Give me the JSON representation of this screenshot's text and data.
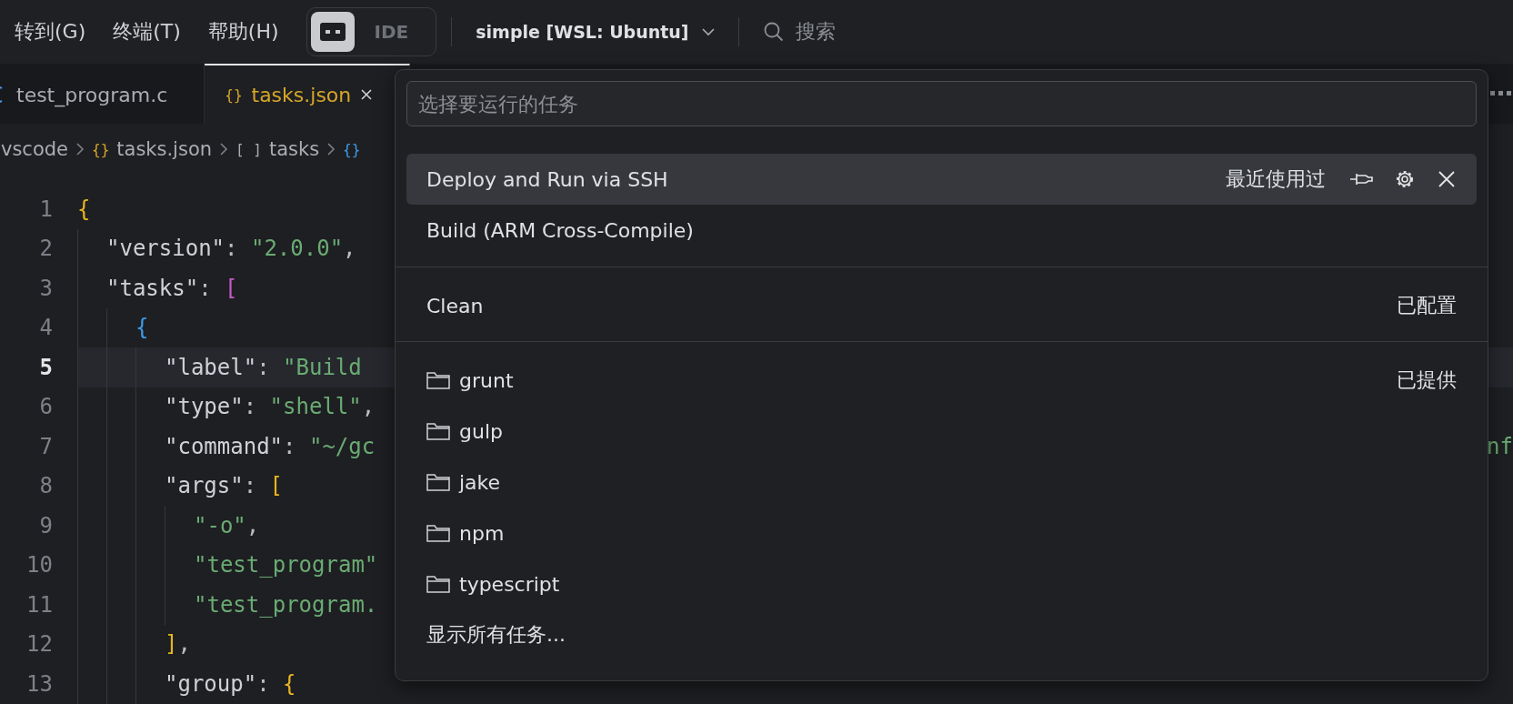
{
  "menu": [
    {
      "label": "转到(G)"
    },
    {
      "label": "终端(T)"
    },
    {
      "label": "帮助(H)"
    }
  ],
  "layout_toggle": {
    "label": "IDE",
    "icon_selected": true
  },
  "workspace": {
    "label": "simple [WSL: Ubuntu]"
  },
  "search": {
    "placeholder": "搜索"
  },
  "tabs": [
    {
      "label": "test_program.c",
      "kind": "c",
      "selected": false
    },
    {
      "label": "tasks.json",
      "kind": "json",
      "icon": "{}",
      "selected": true
    }
  ],
  "breadcrumb": [
    {
      "label": "vscode"
    },
    {
      "label": "tasks.json",
      "kind": "json",
      "icon": "{}"
    },
    {
      "label": "tasks",
      "kind": "array",
      "icon": "[ ]"
    },
    {
      "kind": "object",
      "icon": "{}"
    }
  ],
  "code": [
    {
      "number": "1",
      "current": false,
      "tokens": [
        {
          "text": "{",
          "kind": "b1"
        }
      ],
      "children": [
        {
          "number": "2",
          "current": false,
          "tokens": [
            {
              "text": "\"version\"",
              "kind": "key"
            },
            {
              "text": ": ",
              "kind": "p"
            },
            {
              "text": "\"2.0.0\"",
              "kind": "str"
            },
            {
              "text": ",",
              "kind": "p"
            }
          ]
        },
        {
          "number": "3",
          "current": false,
          "tokens": [
            {
              "text": "\"tasks\"",
              "kind": "key"
            },
            {
              "text": ": ",
              "kind": "p"
            },
            {
              "text": "[",
              "kind": "b2"
            }
          ],
          "children": [
            {
              "number": "4",
              "current": false,
              "tokens": [
                {
                  "text": "{",
                  "kind": "b3"
                }
              ],
              "children": [
                {
                  "number": "5",
                  "current": true,
                  "tokens": [
                    {
                      "text": "\"label\"",
                      "kind": "key"
                    },
                    {
                      "text": ": ",
                      "kind": "p"
                    },
                    {
                      "text": "\"Build",
                      "kind": "str"
                    }
                  ]
                },
                {
                  "number": "6",
                  "current": false,
                  "tokens": [
                    {
                      "text": "\"type\"",
                      "kind": "key"
                    },
                    {
                      "text": ": ",
                      "kind": "p"
                    },
                    {
                      "text": "\"shell\"",
                      "kind": "str"
                    },
                    {
                      "text": ",",
                      "kind": "p"
                    }
                  ]
                },
                {
                  "number": "7",
                  "current": false,
                  "tokens": [
                    {
                      "text": "\"command\"",
                      "kind": "key"
                    },
                    {
                      "text": ": ",
                      "kind": "p"
                    },
                    {
                      "text": "\"~/gc",
                      "kind": "str"
                    }
                  ],
                  "tail": "nf"
                },
                {
                  "number": "8",
                  "current": false,
                  "tokens": [
                    {
                      "text": "\"args\"",
                      "kind": "key"
                    },
                    {
                      "text": ": ",
                      "kind": "p"
                    },
                    {
                      "text": "[",
                      "kind": "b1"
                    }
                  ],
                  "children": [
                    {
                      "number": "9",
                      "current": false,
                      "tokens": [
                        {
                          "text": "\"-o\"",
                          "kind": "str"
                        },
                        {
                          "text": ",",
                          "kind": "p"
                        }
                      ]
                    },
                    {
                      "number": "10",
                      "current": false,
                      "tokens": [
                        {
                          "text": "\"test_program\"",
                          "kind": "str"
                        }
                      ]
                    },
                    {
                      "number": "11",
                      "current": false,
                      "tokens": [
                        {
                          "text": "\"test_program.",
                          "kind": "str"
                        }
                      ]
                    }
                  ]
                },
                {
                  "number": "12",
                  "current": false,
                  "tokens": [
                    {
                      "text": "]",
                      "kind": "b1"
                    },
                    {
                      "text": ",",
                      "kind": "p"
                    }
                  ]
                },
                {
                  "number": "13",
                  "current": false,
                  "tokens": [
                    {
                      "text": "\"group\"",
                      "kind": "key"
                    },
                    {
                      "text": ": ",
                      "kind": "p"
                    },
                    {
                      "text": "{",
                      "kind": "b1"
                    }
                  ]
                }
              ]
            }
          ]
        }
      ]
    }
  ],
  "quick_pick": {
    "placeholder": "选择要运行的任务",
    "sections": [
      {
        "items": [
          {
            "label": "Deploy and Run via SSH",
            "kind": "task",
            "tag": "最近使用过",
            "selected": true
          },
          {
            "label": "Build (ARM Cross-Compile)",
            "kind": "task",
            "selected": false
          }
        ]
      },
      {
        "items": [
          {
            "label": "Clean",
            "kind": "task",
            "tag": "已配置",
            "selected": false
          }
        ]
      },
      {
        "items": [
          {
            "label": "grunt",
            "kind": "provider",
            "tag": "已提供",
            "selected": false
          },
          {
            "label": "gulp",
            "kind": "provider",
            "selected": false
          },
          {
            "label": "jake",
            "kind": "provider",
            "selected": false
          },
          {
            "label": "npm",
            "kind": "provider",
            "selected": false
          },
          {
            "label": "typescript",
            "kind": "provider",
            "selected": false
          },
          {
            "label": "显示所有任务...",
            "kind": "more",
            "selected": false
          }
        ]
      }
    ]
  }
}
